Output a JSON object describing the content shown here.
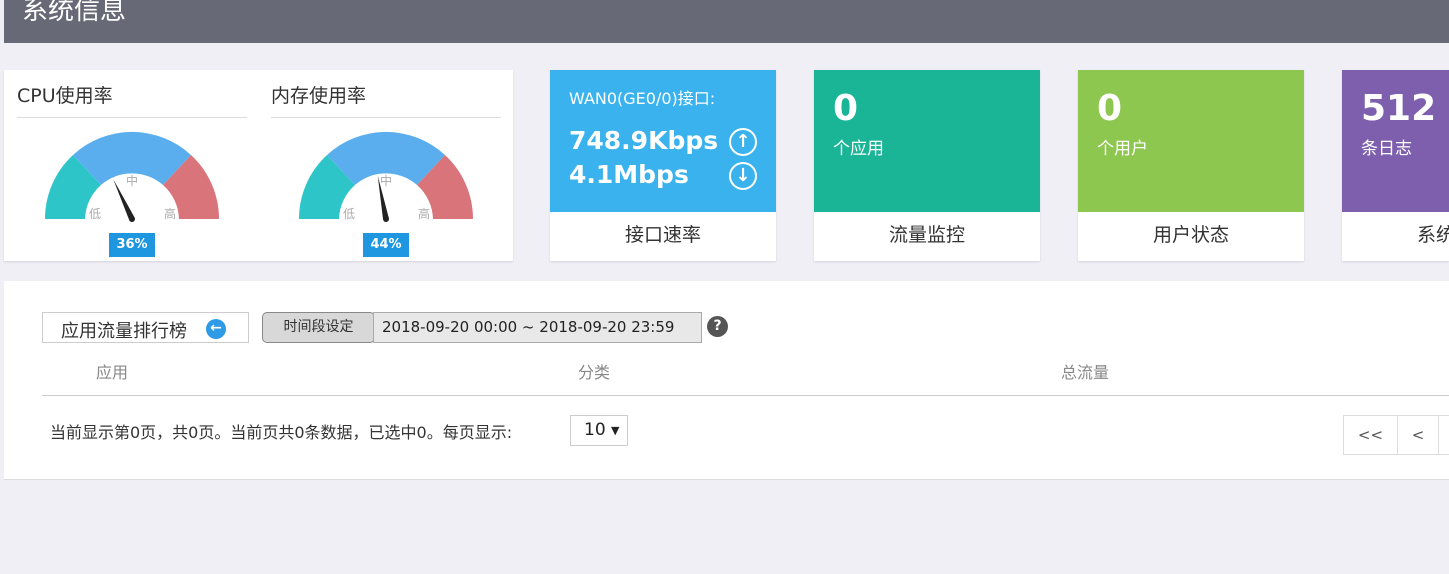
{
  "header": {
    "title": "系统信息"
  },
  "gauges": [
    {
      "title": "CPU使用率",
      "value_label": "36%",
      "value": 0.36,
      "low": "低",
      "mid": "中",
      "high": "高"
    },
    {
      "title": "内存使用率",
      "value_label": "44%",
      "value": 0.44,
      "low": "低",
      "mid": "中",
      "high": "高"
    }
  ],
  "wan": {
    "heading": "WAN0(GE0/0)接口:",
    "up": "748.9Kbps",
    "down": "4.1Mbps",
    "footer": "接口速率",
    "color": "#3ab2ee"
  },
  "cards": [
    {
      "value": "0",
      "label": "个应用",
      "footer": "流量监控",
      "color": "#1ab596"
    },
    {
      "value": "0",
      "label": "个用户",
      "footer": "用户状态",
      "color": "#8dc750"
    },
    {
      "value": "512",
      "label": "条日志",
      "footer": "系统日志",
      "color": "#7d5fad"
    }
  ],
  "ranking": {
    "title": "应用流量排行榜",
    "time_button": "时间段设定",
    "time_range": "2018-09-20 00:00   ~   2018-09-20 23:59",
    "columns": [
      "应用",
      "分类",
      "总流量"
    ],
    "pager_info": "当前显示第0页，共0页。当前页共0条数据，已选中0。每页显示:",
    "page_size": "10",
    "first_label": "<<",
    "prev_label": "<"
  },
  "colors": {
    "gauge_low": "#2ec5c9",
    "gauge_mid": "#5aaeed",
    "gauge_high": "#d9747b",
    "badge": "#1e96e0"
  }
}
